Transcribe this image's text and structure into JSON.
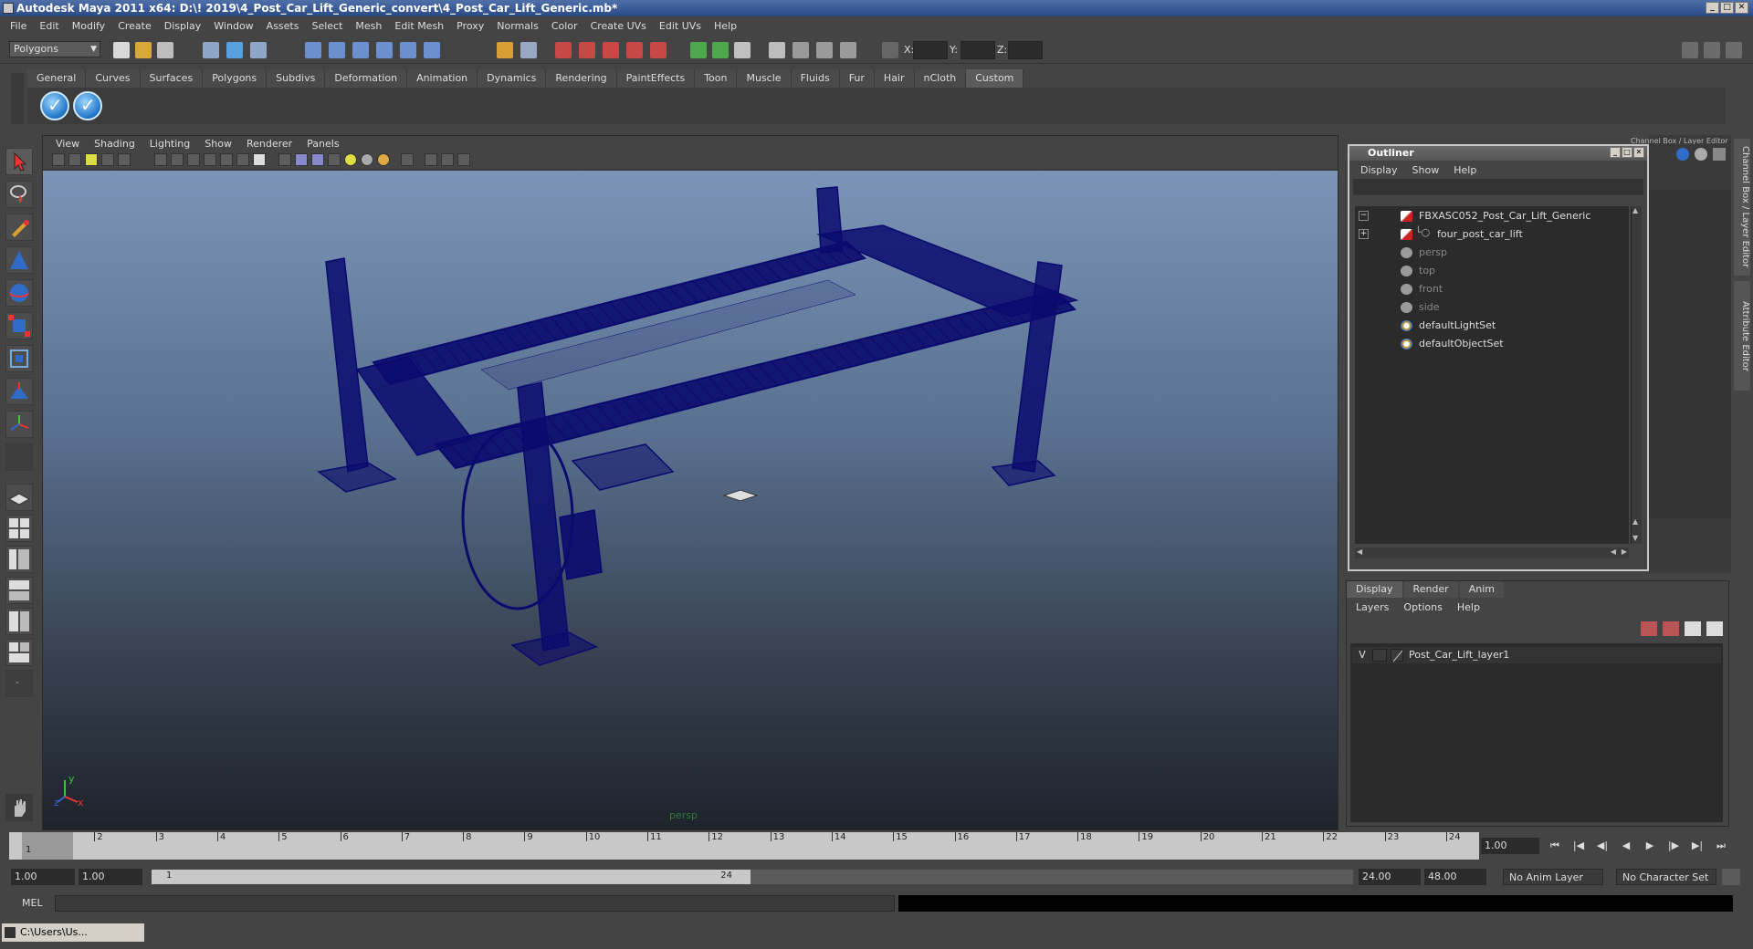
{
  "window": {
    "title": "Autodesk Maya 2011 x64: D:\\! 2019\\4_Post_Car_Lift_Generic_convert\\4_Post_Car_Lift_Generic.mb*"
  },
  "menubar": [
    "File",
    "Edit",
    "Modify",
    "Create",
    "Display",
    "Window",
    "Assets",
    "Select",
    "Mesh",
    "Edit Mesh",
    "Proxy",
    "Normals",
    "Color",
    "Create UVs",
    "Edit UVs",
    "Help"
  ],
  "statusline": {
    "mode": "Polygons",
    "x_label": "X:",
    "y_label": "Y:",
    "z_label": "Z:"
  },
  "shelf": {
    "tabs": [
      "General",
      "Curves",
      "Surfaces",
      "Polygons",
      "Subdivs",
      "Deformation",
      "Animation",
      "Dynamics",
      "Rendering",
      "PaintEffects",
      "Toon",
      "Muscle",
      "Fluids",
      "Fur",
      "Hair",
      "nCloth",
      "Custom"
    ],
    "active_tab": "Custom"
  },
  "viewport": {
    "menu": [
      "View",
      "Shading",
      "Lighting",
      "Show",
      "Renderer",
      "Panels"
    ],
    "camera_label": "persp",
    "axis_y": "y",
    "axis_z": "z",
    "axis_x": "x",
    "wire_color": "#0a0a6e"
  },
  "outliner": {
    "title": "Outliner",
    "menu": [
      "Display",
      "Show",
      "Help"
    ],
    "items": [
      {
        "label": "FBXASC052_Post_Car_Lift_Generic",
        "expander": "−",
        "icon": "transform-icon",
        "dim": false
      },
      {
        "label": "four_post_car_lift",
        "expander": "+",
        "icon": "transform-icon",
        "dim": false
      },
      {
        "label": "persp",
        "expander": "",
        "icon": "camera-icon",
        "dim": true
      },
      {
        "label": "top",
        "expander": "",
        "icon": "camera-icon",
        "dim": true
      },
      {
        "label": "front",
        "expander": "",
        "icon": "camera-icon",
        "dim": true
      },
      {
        "label": "side",
        "expander": "",
        "icon": "camera-icon",
        "dim": true
      },
      {
        "label": "defaultLightSet",
        "expander": "",
        "icon": "set-icon",
        "dim": false
      },
      {
        "label": "defaultObjectSet",
        "expander": "",
        "icon": "set-icon",
        "dim": false
      }
    ]
  },
  "channelbox": {
    "header": "Channel Box / Layer Editor",
    "side_tab_1": "Channel Box / Layer Editor",
    "side_tab_2": "Attribute Editor"
  },
  "layer_editor": {
    "tabs": [
      "Display",
      "Render",
      "Anim"
    ],
    "active_tab": "Display",
    "menu": [
      "Layers",
      "Options",
      "Help"
    ],
    "layers": [
      {
        "visible": "V",
        "name": "Post_Car_Lift_layer1"
      }
    ]
  },
  "timeline": {
    "ticks": [
      "1",
      "2",
      "3",
      "4",
      "5",
      "6",
      "7",
      "8",
      "9",
      "10",
      "11",
      "12",
      "13",
      "14",
      "15",
      "16",
      "17",
      "18",
      "19",
      "20",
      "21",
      "22",
      "23",
      "24"
    ],
    "current_frame_marker": "1",
    "current_time": "1.00"
  },
  "range": {
    "start_time": "1.00",
    "range_start": "1.00",
    "thumb_start": "1",
    "thumb_end": "24",
    "range_end": "24.00",
    "end_time": "48.00",
    "anim_layer": "No Anim Layer",
    "character_set": "No Character Set"
  },
  "command_line": {
    "label": "MEL"
  },
  "taskbar": {
    "minimized_window": "C:\\Users\\Us..."
  }
}
